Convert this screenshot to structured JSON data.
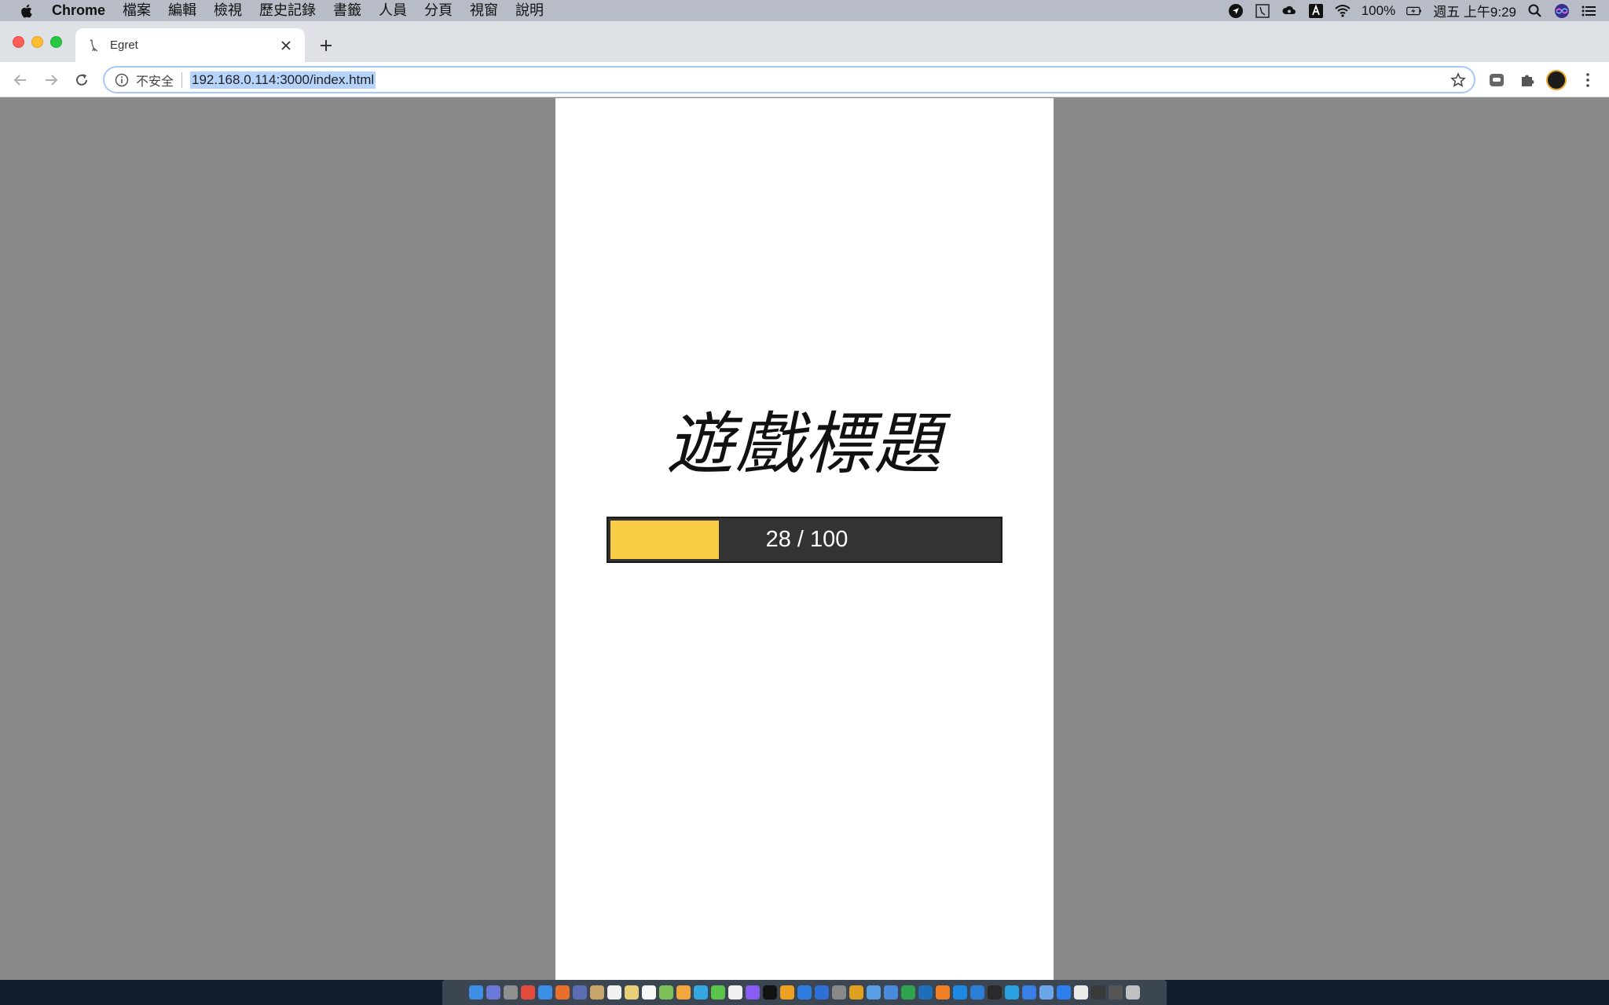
{
  "menubar": {
    "app_name": "Chrome",
    "items": [
      "檔案",
      "編輯",
      "檢視",
      "歷史記錄",
      "書籤",
      "人員",
      "分頁",
      "視窗",
      "說明"
    ],
    "battery": "100%",
    "clock": "週五 上午9:29"
  },
  "browser": {
    "tab_title": "Egret",
    "security_label": "不安全",
    "url": "192.168.0.114:3000/index.html"
  },
  "game": {
    "title": "遊戲標題",
    "progress_text": "28 / 100",
    "progress_value": 28,
    "progress_max": 100,
    "bar_color": "#f9cd45",
    "track_color": "#333333"
  },
  "dock": {
    "icon_colors": [
      "#3f8fe8",
      "#6a78d8",
      "#8f8f8f",
      "#e34c3a",
      "#3a8ee6",
      "#e8702c",
      "#5b6db3",
      "#c8a36a",
      "#f1f1f1",
      "#e8d07a",
      "#f6f6f6",
      "#7fbf5a",
      "#f3a63c",
      "#34a6e0",
      "#5ac44b",
      "#f0f0f0",
      "#8a5cf6",
      "#111111",
      "#f0a020",
      "#2f7de0",
      "#2e6fd8",
      "#888888",
      "#e0a020",
      "#5aa0e8",
      "#4a8be0",
      "#2ea44f",
      "#1d6fb8",
      "#f07f22",
      "#1e88e5",
      "#2b7fd6",
      "#2a2a2a",
      "#2aa0e0",
      "#3a7fe8",
      "#6aa6e8",
      "#2d7ff0",
      "#eaeaea",
      "#3a3a3a",
      "#555555",
      "#c0c0c0"
    ]
  }
}
